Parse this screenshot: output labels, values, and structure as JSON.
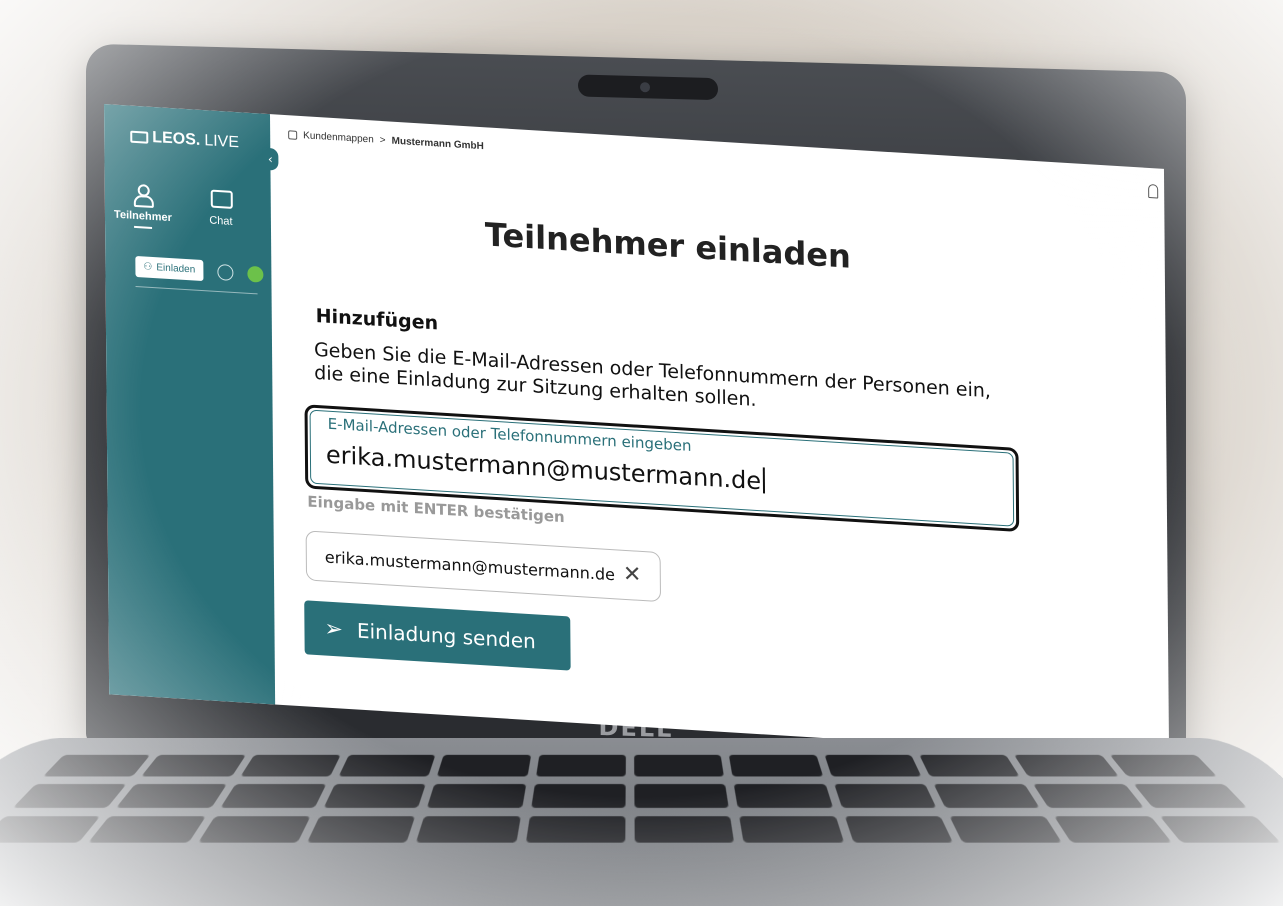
{
  "app": {
    "logo": "LEOS.LIVE",
    "logo_bold": "LEOS.",
    "logo_light": "LIVE"
  },
  "sidebar": {
    "collapse_icon": "chevron-left-icon",
    "nav": [
      {
        "label": "Teilnehmer",
        "icon": "person-icon",
        "active": true
      },
      {
        "label": "Chat",
        "icon": "chat-icon",
        "active": false
      }
    ],
    "invite_button": "Einladen",
    "accent_color": "#2a7079"
  },
  "breadcrumb": {
    "root": "Kundenmappen",
    "separator": ">",
    "current": "Mustermann GmbH"
  },
  "page": {
    "title": "Teilnehmer einladen",
    "section_title": "Hinzufügen",
    "description": "Geben Sie die E-Mail-Adressen oder Telefonnummern der Personen ein, die eine Einladung zur Sitzung erhalten sollen.",
    "input_label": "E-Mail-Adressen oder Telefonnummern eingeben",
    "input_value": "erika.mustermann@mustermann.de",
    "hint": "Eingabe mit ENTER bestätigen",
    "recipients": [
      "erika.mustermann@mustermann.de"
    ],
    "send_button": "Einladung senden"
  },
  "device": {
    "brand": "DELL"
  }
}
